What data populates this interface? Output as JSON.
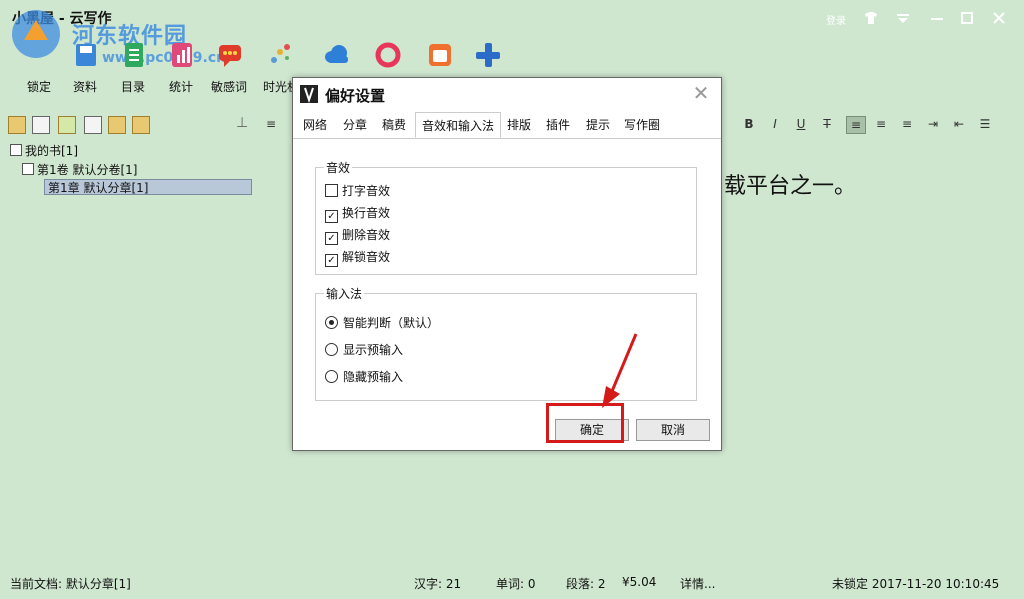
{
  "app": {
    "title": "小黑屋 - 云写作",
    "login": "登录"
  },
  "watermark": {
    "text": "河东软件园",
    "url": "www.pc0359.cn"
  },
  "toolbar": {
    "items": [
      {
        "label": "锁定",
        "icon": "lock-icon"
      },
      {
        "label": "资料",
        "icon": "save-icon"
      },
      {
        "label": "目录",
        "icon": "document-icon"
      },
      {
        "label": "统计",
        "icon": "chart-icon"
      },
      {
        "label": "敏感词",
        "icon": "chat-icon"
      },
      {
        "label": "时光机",
        "icon": "timeline-icon"
      },
      {
        "label": "",
        "icon": "cloud-icon"
      },
      {
        "label": "",
        "icon": "ring-icon"
      },
      {
        "label": "",
        "icon": "calendar-icon"
      },
      {
        "label": "",
        "icon": "plus-icon"
      }
    ]
  },
  "tree": {
    "root": "我的书[1]",
    "volume": "第1卷 默认分卷[1]",
    "chapter": "第1章 默认分章[1]"
  },
  "editor": {
    "text": "载平台之一。"
  },
  "format": {
    "bold": "B",
    "italic": "I",
    "underline": "U",
    "strike": "T"
  },
  "status": {
    "current_doc": "当前文档: 默认分章[1]",
    "chars": "汉字: 21",
    "words": "单词: 0",
    "paragraphs": "段落: 2",
    "price": "¥5.04",
    "details": "详情...",
    "lock_time": "未锁定 2017-11-20 10:10:45"
  },
  "dialog": {
    "title": "偏好设置",
    "tabs": [
      "网络",
      "分章",
      "稿费",
      "音效和输入法",
      "排版",
      "插件",
      "提示",
      "写作圈"
    ],
    "active_tab": "音效和输入法",
    "sound": {
      "title": "音效",
      "options": [
        {
          "label": "打字音效",
          "checked": false
        },
        {
          "label": "换行音效",
          "checked": true
        },
        {
          "label": "删除音效",
          "checked": true
        },
        {
          "label": "解锁音效",
          "checked": true
        }
      ]
    },
    "ime": {
      "title": "输入法",
      "options": [
        {
          "label": "智能判断（默认）",
          "selected": true
        },
        {
          "label": "显示预输入",
          "selected": false
        },
        {
          "label": "隐藏预输入",
          "selected": false
        }
      ]
    },
    "ok": "确定",
    "cancel": "取消"
  },
  "colors": {
    "app_bg": "#cfe6cf",
    "highlight": "#d51a1a",
    "accent": "#3f8ee0"
  }
}
